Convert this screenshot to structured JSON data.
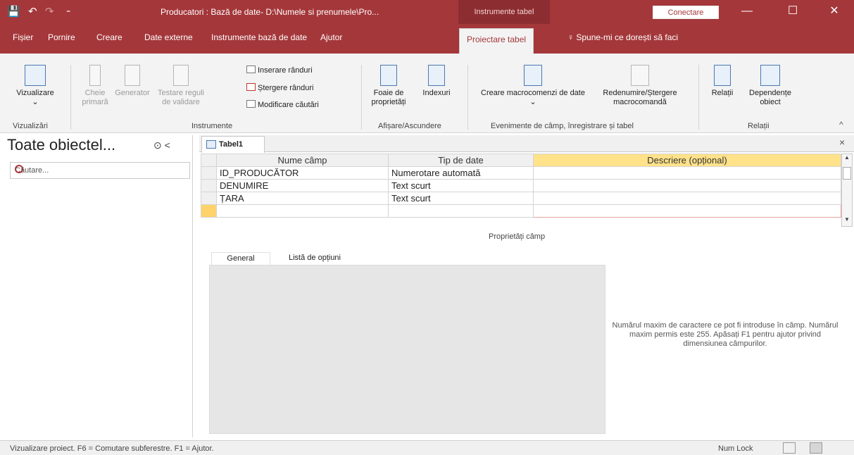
{
  "window": {
    "title": "Producatori : Bază de date- D:\\Numele si prenumele\\Pro...",
    "context_tab": "Instrumente tabel",
    "connect_button": "Conectare",
    "minimize": "—",
    "maximize": "☐",
    "close": "✕"
  },
  "quick_access": {
    "save": "💾",
    "undo": "↶",
    "redo": "↷",
    "customize": "₌"
  },
  "menu": {
    "tabs": [
      "Fișier",
      "Pornire",
      "Creare",
      "Date externe",
      "Instrumente bază de date",
      "Ajutor",
      "Proiectare tabel"
    ],
    "tell_me": "Spune-mi ce dorești să faci"
  },
  "ribbon": {
    "view": "Vizualizare",
    "view_group": "Vizualizări",
    "primary_key": "Cheie primară",
    "builder": "Generator",
    "test_rules": "Testare reguli de validare",
    "insert_rows": "Inserare rânduri",
    "delete_rows": "Ștergere rânduri",
    "modify_lookups": "Modificare căutări",
    "tools_group": "Instrumente",
    "property_sheet": "Foaie de proprietăți",
    "indexes": "Indexuri",
    "show_hide_group": "Afișare/Ascundere",
    "create_macros": "Creare macrocomenzi de date",
    "rename_delete_macro": "Redenumire/Ștergere macrocomandă",
    "events_group": "Evenimente de câmp, înregistrare și tabel",
    "relationships": "Relații",
    "object_dependencies": "Dependențe obiect",
    "relationships_group": "Relații"
  },
  "nav": {
    "title": "Toate obiectel...",
    "search_placeholder": "Căutare...",
    "arrows": "⊙ <"
  },
  "doc": {
    "tab": "Tabel1",
    "close": "×"
  },
  "grid": {
    "headers": [
      "Nume câmp",
      "Tip de date",
      "Descriere (opțional)"
    ],
    "rows": [
      {
        "name": "ID_PRODUCĂTOR",
        "type": "Numerotare automată",
        "desc": ""
      },
      {
        "name": "DENUMIRE",
        "type": "Text scurt",
        "desc": ""
      },
      {
        "name": "ȚARA",
        "type": "Text scurt",
        "desc": ""
      },
      {
        "name": "",
        "type": "",
        "desc": ""
      }
    ]
  },
  "field_properties": {
    "title": "Proprietăți câmp",
    "tabs": [
      "General",
      "Listă de opțiuni"
    ],
    "help": "Numărul maxim de caractere ce pot fi introduse în câmp. Numărul maxim permis este 255. Apăsați F1 pentru ajutor privind dimensiunea câmpurilor."
  },
  "status": {
    "text": "Vizualizare proiect.  F6 = Comutare subferestre.  F1 = Ajutor.",
    "num_lock": "Num Lock"
  },
  "colors": {
    "accent": "#a4373a",
    "header_highlight": "#ffe28a",
    "row_selector": "#ffd36b"
  }
}
